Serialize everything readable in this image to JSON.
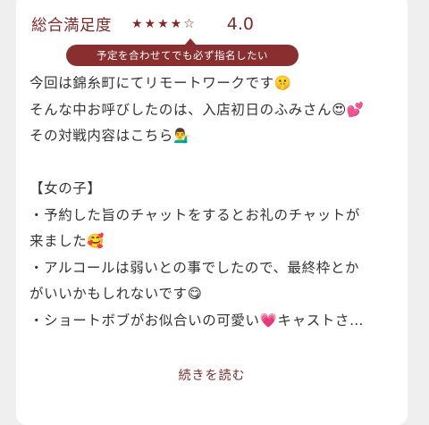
{
  "rating": {
    "label": "総合満足度",
    "stars_filled": "★★★★",
    "stars_empty": "☆",
    "star_count": 4,
    "star_max": 5,
    "score": "4.0",
    "tooltip": "予定を合わせてでも必ず指名したい"
  },
  "review": {
    "lines": [
      "今回は錦糸町にてリモートワークです🤫",
      "そんな中お呼びしたのは、入店初日のふみさん😍💕",
      "その対戦内容はこちら💁‍♂️",
      "",
      "【女の子】",
      "・予約した旨のチャットをするとお礼のチャットが",
      "来ました🥰",
      "・アルコールは弱いとの事でしたので、最終枠とか",
      "がいいかもしれないです😋",
      "・ショートボブがお似合いの可愛い💗キャストさ…"
    ],
    "read_more": "続きを読む"
  },
  "colors": {
    "accent": "#7d2a2a",
    "tooltip_bg": "#8a2f2f",
    "text": "#333333",
    "card_bg": "#ffffff",
    "page_bg": "#efefef"
  }
}
